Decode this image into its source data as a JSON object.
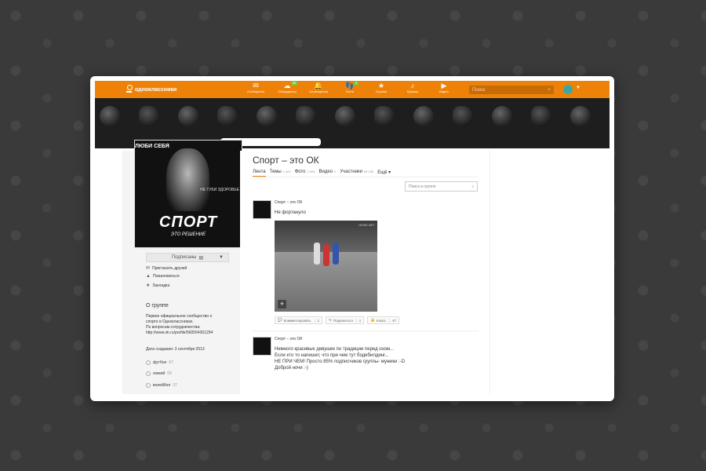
{
  "topbar": {
    "logo_text": "одноклассники",
    "nav": [
      {
        "label": "Сообщения",
        "icon": "envelope-icon",
        "glyph": "✉",
        "badge": ""
      },
      {
        "label": "Обсуждения",
        "icon": "chat-icon",
        "glyph": "☁",
        "badge": "88"
      },
      {
        "label": "Оповещения",
        "icon": "bell-icon",
        "glyph": "🔔",
        "badge": ""
      },
      {
        "label": "Гости",
        "icon": "footprints-icon",
        "glyph": "👣",
        "badge": "9"
      },
      {
        "label": "Оценки",
        "icon": "rating-icon",
        "glyph": "★",
        "badge": ""
      },
      {
        "label": "Музыка",
        "icon": "music-icon",
        "glyph": "♪",
        "badge": ""
      },
      {
        "label": "Видео",
        "icon": "video-icon",
        "glyph": "▶",
        "badge": ""
      }
    ],
    "search_placeholder": "Поиск"
  },
  "group": {
    "photo_title": "ЛЮБИ СЕБЯ",
    "photo_side_text": "НЕ ГУБИ ЗДОРОВЬЕ",
    "photo_big_text": "СПОРТ",
    "photo_sub_text": "ЭТО РЕШЕНИЕ",
    "subscribed_label": "Подписаны",
    "actions": [
      {
        "label": "Пригласить друзей",
        "icon": "invite-icon",
        "glyph": "✉"
      },
      {
        "label": "Пожаловаться",
        "icon": "warning-icon",
        "glyph": "▲"
      },
      {
        "label": "Закладка",
        "icon": "bookmark-icon",
        "glyph": "★"
      }
    ],
    "about_title": "О группе",
    "about_lines": [
      "Первое официальное сообщество о",
      "спорте в Одноклассниках.",
      "По вопросам сотрудничества:",
      "http://www.ok.ru/profile/560554301294"
    ],
    "created": "Дата создания: 3 сентября 2013",
    "tags": [
      {
        "name": "футбол",
        "count": "67"
      },
      {
        "name": "хоккей",
        "count": "69"
      },
      {
        "name": "волейбол",
        "count": "37"
      }
    ]
  },
  "main": {
    "title": "Спорт – это ОК",
    "tabs": [
      {
        "label": "Лента",
        "count": ""
      },
      {
        "label": "Темы",
        "count": "1 462"
      },
      {
        "label": "Фото",
        "count": "2 694"
      },
      {
        "label": "Видео",
        "count": "0"
      },
      {
        "label": "Участники",
        "count": "89 236"
      },
      {
        "label": "Ещё ▾",
        "count": ""
      }
    ],
    "search_placeholder": "Поиск в группе",
    "posts": [
      {
        "author": "Спорт – это ОК",
        "lines": [
          "Не фортануло"
        ],
        "watermark": "GIFAK.NET",
        "actions": {
          "comment": "Комментировать",
          "comment_count": "1",
          "share": "Поделиться",
          "share_count": "1",
          "like": "Класс",
          "like_count": "47"
        }
      },
      {
        "author": "Спорт – это ОК",
        "lines": [
          "Немного красивых девушек по традиции перед сном...",
          "Если кто то напишет, что при чем тут бодибилдинг...",
          "НЕ ПРИ ЧЕМ!  Просто 85% подписчиков группы-  мужики :-D",
          "Доброй  ночи :-)"
        ]
      }
    ]
  }
}
